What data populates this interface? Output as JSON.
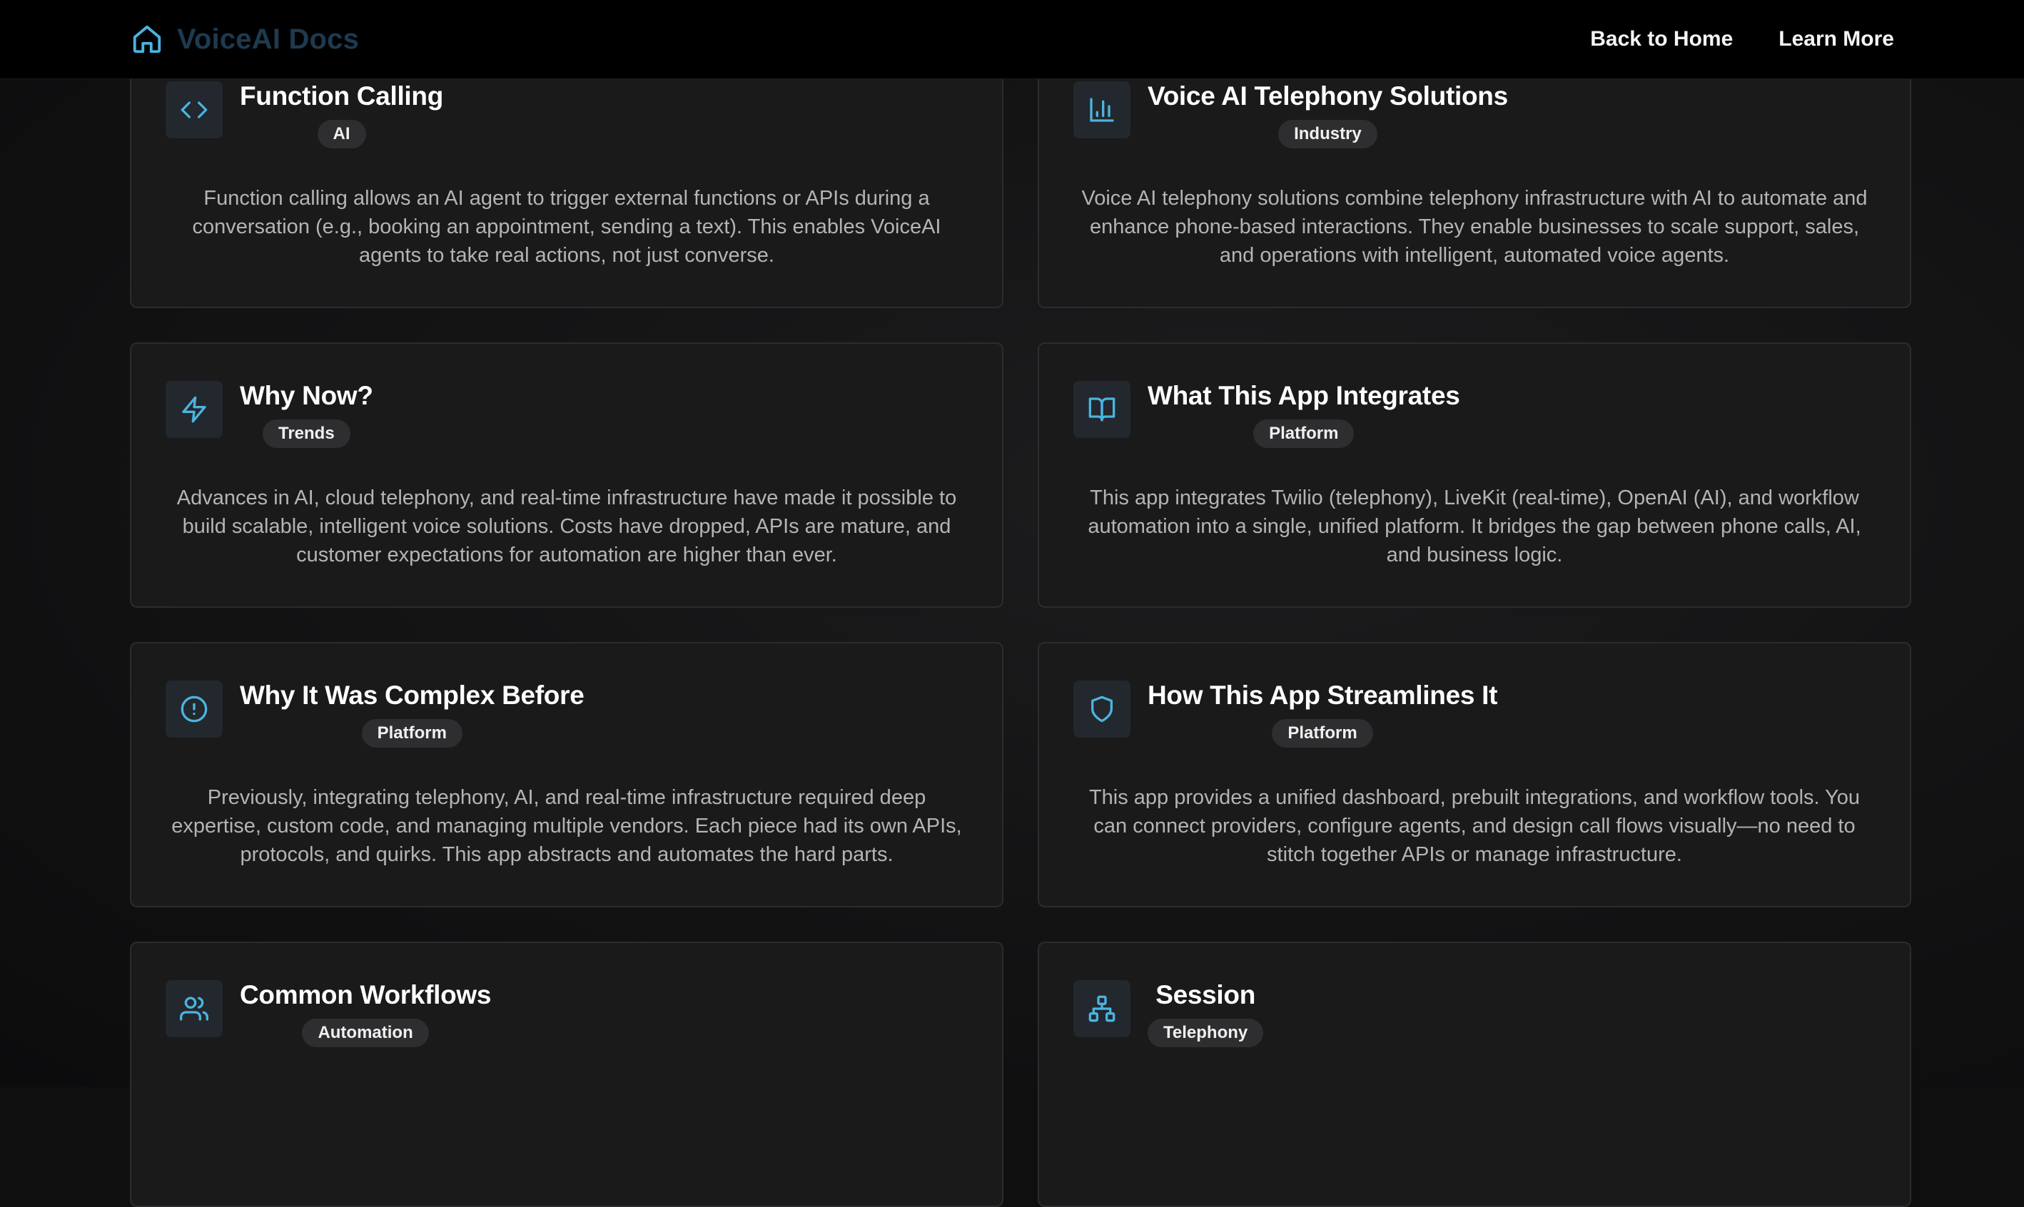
{
  "header": {
    "brand": "VoiceAI Docs",
    "nav": [
      "Back to Home",
      "Learn More"
    ]
  },
  "colors": {
    "accent": "#4cb3e0",
    "brand_text": "#1e3a4f",
    "card_bg": "#1a1a1b",
    "badge_bg": "#2e2e30"
  },
  "cards": [
    {
      "title": "Function Calling",
      "badge": "AI",
      "icon": "code-icon",
      "body": "Function calling allows an AI agent to trigger external functions or APIs during a conversation (e.g., booking an appointment, sending a text). This enables VoiceAI agents to take real actions, not just converse."
    },
    {
      "title": "Voice AI Telephony Solutions",
      "badge": "Industry",
      "icon": "bar-chart-icon",
      "body": "Voice AI telephony solutions combine telephony infrastructure with AI to automate and enhance phone-based interactions. They enable businesses to scale support, sales, and operations with intelligent, automated voice agents."
    },
    {
      "title": "Why Now?",
      "badge": "Trends",
      "icon": "lightning-icon",
      "body": "Advances in AI, cloud telephony, and real-time infrastructure have made it possible to build scalable, intelligent voice solutions. Costs have dropped, APIs are mature, and customer expectations for automation are higher than ever."
    },
    {
      "title": "What This App Integrates",
      "badge": "Platform",
      "icon": "book-open-icon",
      "body": "This app integrates Twilio (telephony), LiveKit (real-time), OpenAI (AI), and workflow automation into a single, unified platform. It bridges the gap between phone calls, AI, and business logic."
    },
    {
      "title": "Why It Was Complex Before",
      "badge": "Platform",
      "icon": "alert-circle-icon",
      "body": "Previously, integrating telephony, AI, and real-time infrastructure required deep expertise, custom code, and managing multiple vendors. Each piece had its own APIs, protocols, and quirks. This app abstracts and automates the hard parts."
    },
    {
      "title": "How This App Streamlines It",
      "badge": "Platform",
      "icon": "shield-icon",
      "body": "This app provides a unified dashboard, prebuilt integrations, and workflow tools. You can connect providers, configure agents, and design call flows visually—no need to stitch together APIs or manage infrastructure."
    },
    {
      "title": "Common Workflows",
      "badge": "Automation",
      "icon": "users-icon",
      "body": ""
    },
    {
      "title": "Session",
      "badge": "Telephony",
      "icon": "network-icon",
      "body": ""
    }
  ]
}
